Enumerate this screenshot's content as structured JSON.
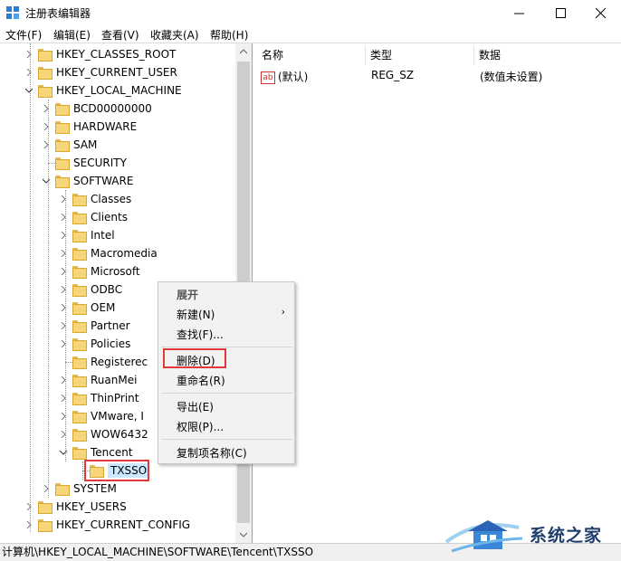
{
  "window": {
    "title": "注册表编辑器",
    "controls": {
      "minimize": "minimize-icon",
      "maximize": "maximize-icon",
      "close": "close-icon"
    }
  },
  "menubar": [
    "文件(F)",
    "编辑(E)",
    "查看(V)",
    "收藏夹(A)",
    "帮助(H)"
  ],
  "tree": {
    "items": [
      "HKEY_CLASSES_ROOT",
      "HKEY_CURRENT_USER",
      "HKEY_LOCAL_MACHINE",
      "BCD00000000",
      "HARDWARE",
      "SAM",
      "SECURITY",
      "SOFTWARE",
      "Classes",
      "Clients",
      "Intel",
      "Macromedia",
      "Microsoft",
      "ODBC",
      "OEM",
      "Partner",
      "Policies",
      "Registerec",
      "RuanMei",
      "ThinPrint",
      "VMware, I",
      "WOW6432",
      "Tencent",
      "TXSSO",
      "SYSTEM",
      "HKEY_USERS",
      "HKEY_CURRENT_CONFIG"
    ]
  },
  "list": {
    "columns": [
      "名称",
      "类型",
      "数据"
    ],
    "rows": [
      {
        "name": "(默认)",
        "type": "REG_SZ",
        "data": "(数值未设置)",
        "icon": "ab"
      }
    ]
  },
  "context_menu": {
    "items": [
      "展开",
      "新建(N)",
      "查找(F)...",
      "删除(D)",
      "重命名(R)",
      "导出(E)",
      "权限(P)...",
      "复制项名称(C)"
    ]
  },
  "statusbar": {
    "path": "计算机\\HKEY_LOCAL_MACHINE\\SOFTWARE\\Tencent\\TXSSO"
  },
  "watermark": {
    "text": "系统之家"
  },
  "colors": {
    "highlight_box": "#e03a3a",
    "folder": "#f7d57b",
    "selected": "#cce8ff"
  }
}
